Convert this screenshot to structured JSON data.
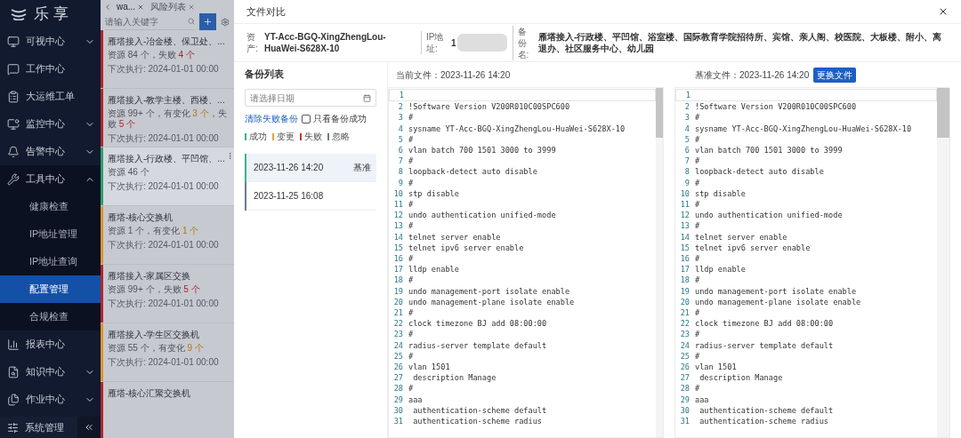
{
  "brand": {
    "name": "乐 享"
  },
  "sidebar": {
    "items": [
      {
        "label": "可视中心",
        "kind": "group",
        "expanded": false
      },
      {
        "label": "工作中心",
        "kind": "link"
      },
      {
        "label": "大运维工单",
        "kind": "link"
      },
      {
        "label": "监控中心",
        "kind": "group",
        "expanded": false
      },
      {
        "label": "告警中心",
        "kind": "group",
        "expanded": false
      },
      {
        "label": "工具中心",
        "kind": "group",
        "expanded": true,
        "children": [
          {
            "label": "健康检查",
            "selected": false
          },
          {
            "label": "IP地址管理",
            "selected": false
          },
          {
            "label": "IP地址查询",
            "selected": false
          },
          {
            "label": "配置管理",
            "selected": true
          },
          {
            "label": "合规检查",
            "selected": false
          }
        ]
      },
      {
        "label": "报表中心",
        "kind": "link"
      },
      {
        "label": "知识中心",
        "kind": "group",
        "expanded": false
      },
      {
        "label": "作业中心",
        "kind": "group",
        "expanded": false
      }
    ],
    "footer": {
      "label": "系统管理"
    }
  },
  "tabs": [
    {
      "label": "wa...",
      "selected": true
    },
    {
      "label": "风险列表",
      "selected": false
    }
  ],
  "task_list": {
    "search_placeholder": "请输入关键字",
    "cards": [
      {
        "title": "雁塔接入-冶金楼、保卫处、...",
        "color": "#b3262e",
        "selected": false,
        "meta": [
          {
            "text": "资源 84 个，失败 ",
            "kind": "plain"
          },
          {
            "text": "4 个",
            "kind": "fail"
          }
        ],
        "next_run": "下次执行: 2024-01-01 00:00"
      },
      {
        "title": "雁塔接入-教学主楼、西楼、...",
        "color": "#b3262e",
        "selected": false,
        "meta": [
          {
            "text": "资源 99+ 个，有变化 ",
            "kind": "plain"
          },
          {
            "text": "3 个",
            "kind": "change"
          },
          {
            "text": "，失败 ",
            "kind": "plain"
          },
          {
            "text": "5 个",
            "kind": "fail"
          }
        ],
        "next_run": "下次执行: 2024-01-01 00:00"
      },
      {
        "title": "雁塔接入-行政楼、平凹馆、...",
        "color": "#2f9e6e",
        "selected": true,
        "meta": [
          {
            "text": "资源 46 个",
            "kind": "plain"
          }
        ],
        "next_run": "下次执行: 2024-01-01 00:00"
      },
      {
        "title": "雁塔-核心交换机",
        "color": "#d9962b",
        "selected": false,
        "meta": [
          {
            "text": "资源 1 个，有变化 ",
            "kind": "plain"
          },
          {
            "text": "1 个",
            "kind": "change"
          }
        ],
        "next_run": "下次执行: 2024-01-01 00:00"
      },
      {
        "title": "雁塔接入-家属区交换",
        "color": "#b3262e",
        "selected": false,
        "meta": [
          {
            "text": "资源 99+ 个，失败 ",
            "kind": "plain"
          },
          {
            "text": "5 个",
            "kind": "fail"
          }
        ],
        "next_run": "下次执行: 2024-01-01 00:00"
      },
      {
        "title": "雁塔接入-学生区交换机",
        "color": "#d9962b",
        "selected": false,
        "meta": [
          {
            "text": "资源 55 个，有变化 ",
            "kind": "plain"
          },
          {
            "text": "9 个",
            "kind": "change"
          }
        ],
        "next_run": "下次执行: 2024-01-01 00:00"
      },
      {
        "title": "雁塔-核心汇聚交换机",
        "color": "#b3262e",
        "selected": false
      }
    ]
  },
  "modal": {
    "title": "文件对比",
    "info": [
      {
        "label": "资产:",
        "value": "YT-Acc-BGQ-XingZhengLou-HuaWei-S628X-10",
        "kind": "text"
      },
      {
        "label": "IP地址:",
        "value": "1",
        "kind": "redacted"
      },
      {
        "label": "备份名:",
        "value": "雁塔接入-行政楼、平凹馆、浴室楼、国际教育学院招待所、宾馆、亲人阁、校医院、大板楼、附小、离退办、社区服务中心、幼儿园",
        "kind": "text"
      }
    ],
    "backups": {
      "title": "备份列表",
      "date_placeholder": "请选择日期",
      "clear_link": "清除失败备份",
      "only_success": {
        "label": "只看备份成功",
        "checked": false
      },
      "legend": [
        {
          "label": "成功",
          "color": "#3bb38a"
        },
        {
          "label": "变更",
          "color": "#e6a23c"
        },
        {
          "label": "失败",
          "color": "#c0392b"
        },
        {
          "label": "忽略",
          "color": "#6b7a90"
        }
      ],
      "items": [
        {
          "time": "2023-11-26 14:20",
          "tag": "基准",
          "color": "#3bb38a",
          "selected": true
        },
        {
          "time": "2023-11-25 16:08",
          "color": "#6b7a90",
          "selected": false
        }
      ]
    },
    "current": {
      "label": "当前文件：2023-11-26 14:20"
    },
    "baseline": {
      "label": "基准文件：2023-11-26 14:20",
      "button": "更换文件"
    },
    "panels": [
      {
        "lines": [
          {
            "no": "1"
          },
          {
            "no": "2",
            "text": "!Software Version V200R010C00SPC600"
          },
          {
            "no": "3",
            "text": "#"
          },
          {
            "no": "4",
            "text": "sysname YT-Acc-BGQ-XingZhengLou-HuaWei-S628X-10"
          },
          {
            "no": "5",
            "text": "#"
          },
          {
            "no": "6",
            "text": "vlan batch 700 1501 3000 to 3999"
          },
          {
            "no": "7",
            "text": "#"
          },
          {
            "no": "8",
            "text": "loopback-detect auto disable"
          },
          {
            "no": "9",
            "text": "#"
          },
          {
            "no": "10",
            "text": "stp disable"
          },
          {
            "no": "11",
            "text": "#"
          },
          {
            "no": "12",
            "text": "undo authentication unified-mode"
          },
          {
            "no": "13",
            "text": "#"
          },
          {
            "no": "14",
            "text": "telnet server enable"
          },
          {
            "no": "15",
            "text": "telnet ipv6 server enable"
          },
          {
            "no": "16",
            "text": "#"
          },
          {
            "no": "17",
            "text": "lldp enable"
          },
          {
            "no": "18",
            "text": "#"
          },
          {
            "no": "19",
            "text": "undo management-port isolate enable"
          },
          {
            "no": "20",
            "text": "undo management-plane isolate enable"
          },
          {
            "no": "21",
            "text": "#"
          },
          {
            "no": "22",
            "text": "clock timezone BJ add 08:00:00"
          },
          {
            "no": "23",
            "text": "#"
          },
          {
            "no": "24",
            "text": "radius-server template default"
          },
          {
            "no": "25",
            "text": "#"
          },
          {
            "no": "26",
            "text": "vlan 1501"
          },
          {
            "no": "27",
            "text": " description Manage"
          },
          {
            "no": "28",
            "text": "#"
          },
          {
            "no": "29",
            "text": "aaa"
          },
          {
            "no": "30",
            "text": " authentication-scheme default"
          },
          {
            "no": "31",
            "text": " authentication-scheme radius"
          }
        ]
      },
      {
        "lines": [
          {
            "no": "1"
          },
          {
            "no": "2",
            "text": "!Software Version V200R010C00SPC600"
          },
          {
            "no": "3",
            "text": "#"
          },
          {
            "no": "4",
            "text": "sysname YT-Acc-BGQ-XingZhengLou-HuaWei-S628X-10"
          },
          {
            "no": "5",
            "text": "#"
          },
          {
            "no": "6",
            "text": "vlan batch 700 1501 3000 to 3999"
          },
          {
            "no": "7",
            "text": "#"
          },
          {
            "no": "8",
            "text": "loopback-detect auto disable"
          },
          {
            "no": "9",
            "text": "#"
          },
          {
            "no": "10",
            "text": "stp disable"
          },
          {
            "no": "11",
            "text": "#"
          },
          {
            "no": "12",
            "text": "undo authentication unified-mode"
          },
          {
            "no": "13",
            "text": "#"
          },
          {
            "no": "14",
            "text": "telnet server enable"
          },
          {
            "no": "15",
            "text": "telnet ipv6 server enable"
          },
          {
            "no": "16",
            "text": "#"
          },
          {
            "no": "17",
            "text": "lldp enable"
          },
          {
            "no": "18",
            "text": "#"
          },
          {
            "no": "19",
            "text": "undo management-port isolate enable"
          },
          {
            "no": "20",
            "text": "undo management-plane isolate enable"
          },
          {
            "no": "21",
            "text": "#"
          },
          {
            "no": "22",
            "text": "clock timezone BJ add 08:00:00"
          },
          {
            "no": "23",
            "text": "#"
          },
          {
            "no": "24",
            "text": "radius-server template default"
          },
          {
            "no": "25",
            "text": "#"
          },
          {
            "no": "26",
            "text": "vlan 1501"
          },
          {
            "no": "27",
            "text": " description Manage"
          },
          {
            "no": "28",
            "text": "#"
          },
          {
            "no": "29",
            "text": "aaa"
          },
          {
            "no": "30",
            "text": " authentication-scheme default"
          },
          {
            "no": "31",
            "text": " authentication-scheme radius"
          }
        ]
      }
    ]
  }
}
